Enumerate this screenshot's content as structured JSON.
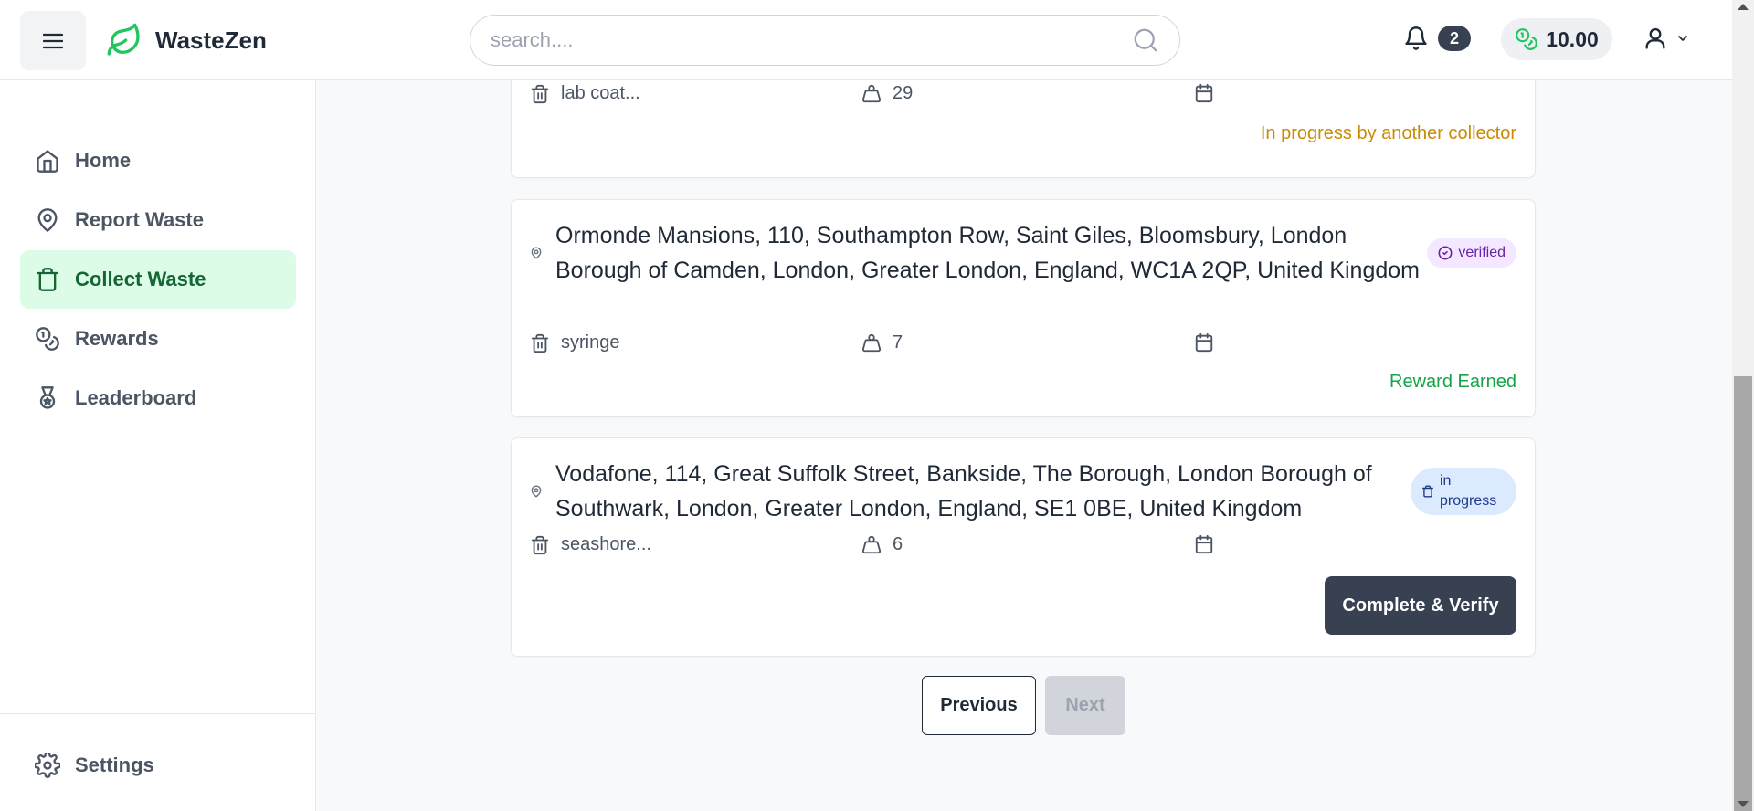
{
  "header": {
    "app_name": "WasteZen",
    "search_placeholder": "search....",
    "notification_count": "2",
    "balance": "10.00"
  },
  "sidebar": {
    "items": [
      {
        "label": "Home",
        "icon": "home-icon"
      },
      {
        "label": "Report Waste",
        "icon": "map-pin-icon"
      },
      {
        "label": "Collect Waste",
        "icon": "trash-icon",
        "active": true
      },
      {
        "label": "Rewards",
        "icon": "coins-icon"
      },
      {
        "label": "Leaderboard",
        "icon": "medal-icon"
      }
    ],
    "settings_label": "Settings"
  },
  "tasks": [
    {
      "waste_type": "lab coat...",
      "amount": "29",
      "date": "",
      "status_text": "In progress by another collector"
    },
    {
      "address": "Ormonde Mansions, 110, Southampton Row, Saint Giles, Bloomsbury, London Borough of Camden, London, Greater London, England, WC1A 2QP, United Kingdom",
      "badge": "verified",
      "waste_type": "syringe",
      "amount": "7",
      "date": "",
      "status_text": "Reward Earned"
    },
    {
      "address": "Vodafone, 114, Great Suffolk Street, Bankside, The Borough, London Borough of Southwark, London, Greater London, England, SE1 0BE, United Kingdom",
      "badge": "in progress",
      "waste_type": "seashore...",
      "amount": "6",
      "date": "",
      "action_label": "Complete & Verify"
    }
  ],
  "pagination": {
    "previous_label": "Previous",
    "next_label": "Next"
  },
  "colors": {
    "brand": "#22c55e",
    "active_nav_bg": "#dcfce7",
    "primary_button": "#374151",
    "warning_text": "#ca8a04",
    "success_text": "#16a34a"
  }
}
